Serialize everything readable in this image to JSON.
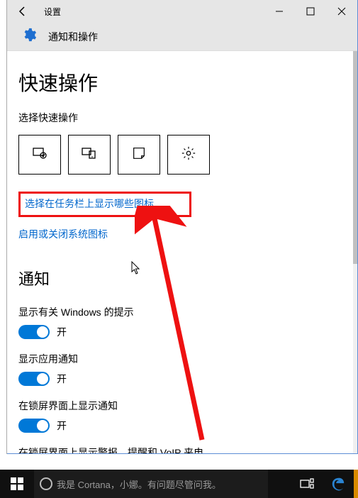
{
  "titlebar": {
    "title": "设置"
  },
  "header": {
    "title": "通知和操作"
  },
  "quick_actions": {
    "heading": "快速操作",
    "choose_label": "选择快速操作"
  },
  "links": {
    "taskbar_icons": "选择在任务栏上显示哪些图标",
    "system_icons": "启用或关闭系统图标"
  },
  "notifications": {
    "heading": "通知",
    "items": [
      {
        "label": "显示有关 Windows 的提示",
        "state": "开"
      },
      {
        "label": "显示应用通知",
        "state": "开"
      },
      {
        "label": "在锁屏界面上显示通知",
        "state": "开"
      }
    ],
    "cutoff": "在锁屏界面上显示警报、提醒和 VoIP 来电"
  },
  "taskbar": {
    "search_placeholder": "我是 Cortana，小娜。有问题尽管问我。"
  }
}
